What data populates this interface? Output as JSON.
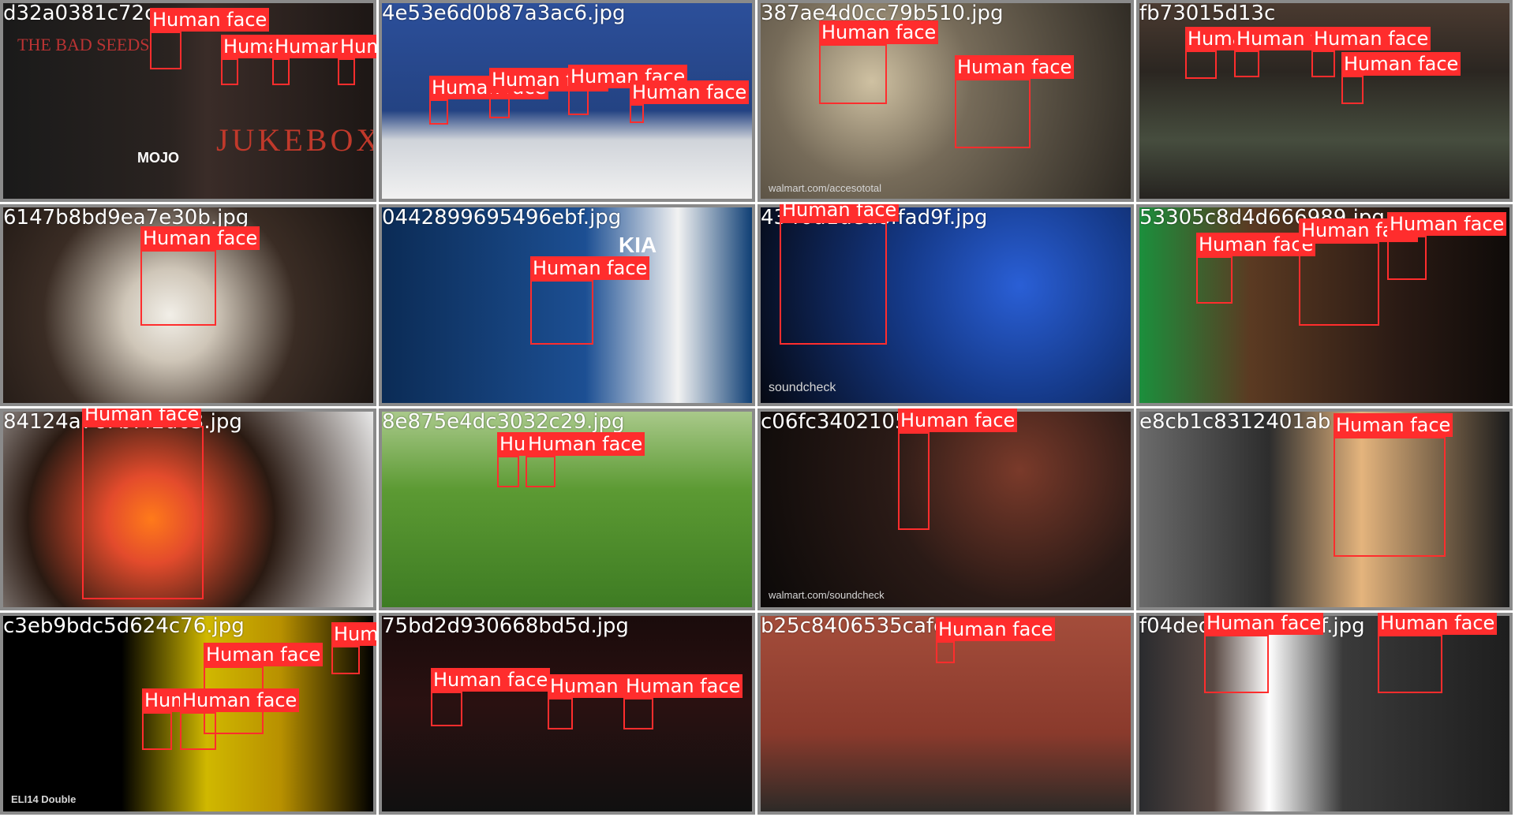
{
  "colors": {
    "box": "#ff2d2d",
    "label_text": "#ffffff",
    "tile_border": "#8a8a8a"
  },
  "tiles": [
    {
      "filename": "d32a0381c72c",
      "label": "Human face",
      "watermark": "MOJO",
      "subtitle": "JUKEBOX"
    },
    {
      "filename": "4e53e6d0b87a3ac6.jpg",
      "label": "Human face"
    },
    {
      "filename": "387ae4d0cc79b510.jpg",
      "label": "Human face",
      "watermark": "walmart.com/accesototal"
    },
    {
      "filename": "fb73015d13c",
      "label": "Human face"
    },
    {
      "filename": "6147b8bd9ea7e30b.jpg",
      "label": "Human face"
    },
    {
      "filename": "0442899695496ebf.jpg",
      "label": "Human face",
      "watermark": "KIA"
    },
    {
      "filename": "4346d1ded8ffad9f.jpg",
      "label": "Human face",
      "watermark": "soundcheck"
    },
    {
      "filename": "53305c8d4d666989.jpg",
      "label": "Human face"
    },
    {
      "filename": "84124a7c7b7f2d63.jpg",
      "label": "Human face"
    },
    {
      "filename": "8e875e4dc3032c29.jpg",
      "label": "Human face"
    },
    {
      "filename": "c06fc3402105",
      "label": "Human face",
      "watermark": "walmart.com/soundcheck"
    },
    {
      "filename": "e8cb1c8312401ab",
      "label": "Human face"
    },
    {
      "filename": "c3eb9bdc5d624c76.jpg",
      "label": "Human face",
      "watermark": "ELI14 Double"
    },
    {
      "filename": "75bd2d930668bd5d.jpg",
      "label": "Human face"
    },
    {
      "filename": "b25c8406535cafe",
      "label": "Human face"
    },
    {
      "filename": "f04ded49a3f53c7f.jpg",
      "label": "Human face"
    }
  ]
}
